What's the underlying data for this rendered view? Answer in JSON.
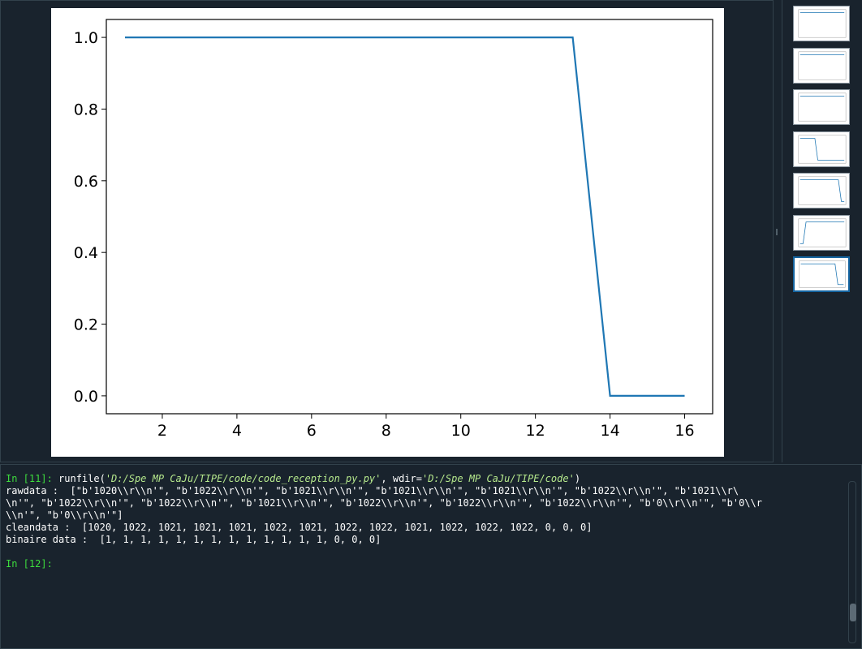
{
  "chart_data": {
    "type": "line",
    "x": [
      1,
      2,
      3,
      4,
      5,
      6,
      7,
      8,
      9,
      10,
      11,
      12,
      13,
      14,
      15,
      16
    ],
    "series": [
      {
        "values": [
          1,
          1,
          1,
          1,
          1,
          1,
          1,
          1,
          1,
          1,
          1,
          1,
          1,
          0,
          0,
          0
        ],
        "color": "#1f77b4"
      }
    ],
    "xlim": [
      0.5,
      16.75
    ],
    "ylim": [
      -0.05,
      1.05
    ],
    "xticks": [
      2,
      4,
      6,
      8,
      10,
      12,
      14,
      16
    ],
    "yticks": [
      0.0,
      0.2,
      0.4,
      0.6,
      0.8,
      1.0
    ],
    "title": "",
    "xlabel": "",
    "ylabel": "",
    "grid": false
  },
  "thumbnails": [
    {
      "series": [
        1,
        1,
        1,
        1,
        1,
        1,
        1,
        1,
        1,
        1,
        1,
        1,
        1,
        1,
        1,
        1
      ],
      "selected": false
    },
    {
      "series": [
        1,
        1,
        1,
        1,
        1,
        1,
        1,
        1,
        1,
        1,
        1,
        1,
        1,
        1,
        1,
        1
      ],
      "selected": false
    },
    {
      "series": [
        1,
        1,
        1,
        1,
        1,
        1,
        1,
        1,
        1,
        1,
        1,
        1,
        1,
        1,
        1,
        1
      ],
      "selected": false
    },
    {
      "series": [
        1,
        1,
        1,
        1,
        1,
        1,
        0,
        0,
        0,
        0,
        0,
        0,
        0,
        0,
        0,
        0
      ],
      "selected": false
    },
    {
      "series": [
        1,
        1,
        1,
        1,
        1,
        1,
        1,
        1,
        1,
        1,
        1,
        1,
        1,
        1,
        0,
        0
      ],
      "selected": false
    },
    {
      "series": [
        0,
        0,
        1,
        1,
        1,
        1,
        1,
        1,
        1,
        1,
        1,
        1,
        1,
        1,
        1,
        1
      ],
      "selected": false
    },
    {
      "series": [
        1,
        1,
        1,
        1,
        1,
        1,
        1,
        1,
        1,
        1,
        1,
        1,
        1,
        0,
        0,
        0
      ],
      "selected": true
    }
  ],
  "console": {
    "in11_prompt": "In [11]:",
    "in11_cmd_pre": " runfile(",
    "in11_arg1": "'D:/Spe MP CaJu/TIPE/code/code_reception_py.py'",
    "in11_mid": ", wdir=",
    "in11_arg2": "'D:/Spe MP CaJu/TIPE/code'",
    "in11_end": ")",
    "rawdata_line1": "rawdata :  [\"b'1020\\\\r\\\\n'\", \"b'1022\\\\r\\\\n'\", \"b'1021\\\\r\\\\n'\", \"b'1021\\\\r\\\\n'\", \"b'1021\\\\r\\\\n'\", \"b'1022\\\\r\\\\n'\", \"b'1021\\\\r\\",
    "rawdata_line2": "\\n'\", \"b'1022\\\\r\\\\n'\", \"b'1022\\\\r\\\\n'\", \"b'1021\\\\r\\\\n'\", \"b'1022\\\\r\\\\n'\", \"b'1022\\\\r\\\\n'\", \"b'1022\\\\r\\\\n'\", \"b'0\\\\r\\\\n'\", \"b'0\\\\r",
    "rawdata_line3": "\\\\n'\", \"b'0\\\\r\\\\n'\"]",
    "cleandata": "cleandata :  [1020, 1022, 1021, 1021, 1021, 1022, 1021, 1022, 1022, 1021, 1022, 1022, 1022, 0, 0, 0]",
    "binaire": "binaire data :  [1, 1, 1, 1, 1, 1, 1, 1, 1, 1, 1, 1, 1, 0, 0, 0]",
    "in12_prompt": "In [12]:"
  }
}
